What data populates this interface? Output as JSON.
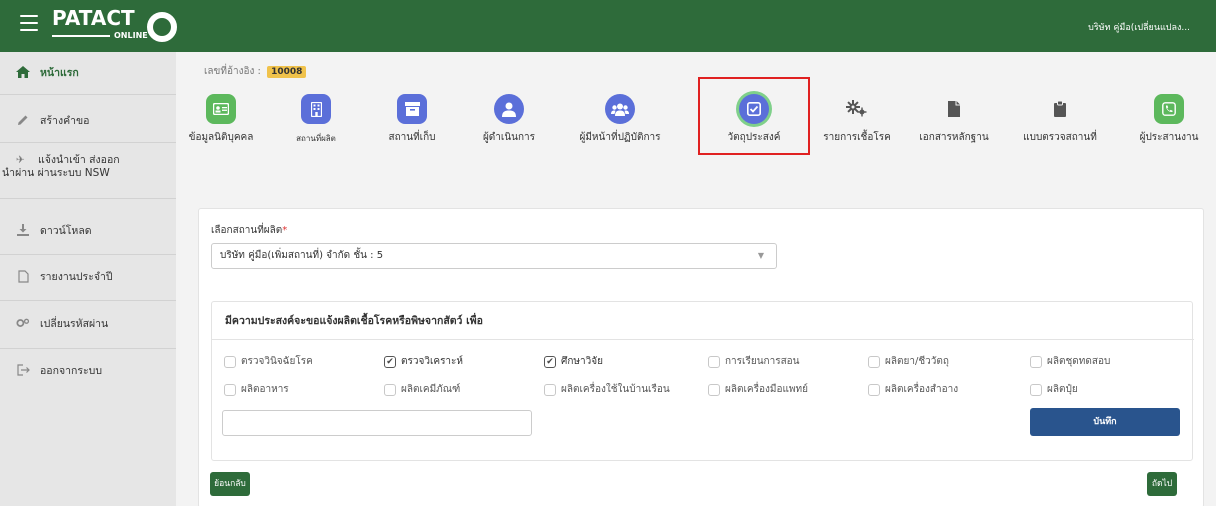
{
  "header": {
    "logo_text": "PATACT",
    "logo_sub": "ONLINE",
    "company": "บริษัท คู่มือ(เปลี่ยนแปลง..."
  },
  "sidebar": {
    "items": [
      {
        "label": "หน้าแรก",
        "icon": "home-icon"
      },
      {
        "label": "สร้างคำขอ",
        "icon": "pencil-icon"
      },
      {
        "label": "แจ้งนำเข้า ส่งออก",
        "label2": "นำผ่าน ผ่านระบบ NSW",
        "icon": "plane-icon"
      },
      {
        "label": "ดาวน์โหลด",
        "icon": "download-icon"
      },
      {
        "label": "รายงานประจำปี",
        "icon": "file-icon"
      },
      {
        "label": "เปลี่ยนรหัสผ่าน",
        "icon": "cogs-icon"
      },
      {
        "label": "ออกจากระบบ",
        "icon": "sign-out-icon"
      }
    ]
  },
  "reference": {
    "label": "เลขที่อ้างอิง :",
    "value": "10008"
  },
  "steps": [
    {
      "label": "ข้อมูลนิติบุคคล",
      "icon": "id-card-icon",
      "color": "#5cb85c"
    },
    {
      "label": "สถานที่ผลิต",
      "icon": "building-icon",
      "color": "#5b6fd9"
    },
    {
      "label": "สถานที่เก็บ",
      "icon": "archive-icon",
      "color": "#5b6fd9"
    },
    {
      "label": "ผู้ดำเนินการ",
      "icon": "user-icon",
      "color": "#5b6fd9"
    },
    {
      "label": "ผู้มีหน้าที่ปฏิบัติการ",
      "icon": "users-icon",
      "color": "#5b6fd9"
    },
    {
      "label": "วัตถุประสงค์",
      "icon": "check-square-icon",
      "color": "#5b6fd9"
    },
    {
      "label": "รายการเชื้อโรค",
      "icon": "cogs-icon",
      "color": "#666666"
    },
    {
      "label": "เอกสารหลักฐาน",
      "icon": "document-icon",
      "color": "#555555"
    },
    {
      "label": "แบบตรวจสถานที่",
      "icon": "clipboard-icon",
      "color": "#555555"
    },
    {
      "label": "ผู้ประสานงาน",
      "icon": "phone-icon",
      "color": "#5cb85c"
    }
  ],
  "form": {
    "select_label": "เลือกสถานที่ผลิต",
    "required_mark": "*",
    "selected_site": "บริษัท คู่มือ(เพิ่มสถานที่) จำกัด ชั้น : 5",
    "purpose_title": "มีความประสงค์จะขอแจ้งผลิตเชื้อโรคหรือพิษจากสัตว์ เพื่อ",
    "checkboxes": [
      {
        "label": "ตรวจวินิจฉัยโรค",
        "checked": false
      },
      {
        "label": "ตรวจวิเคราะห์",
        "checked": true
      },
      {
        "label": "ศึกษาวิจัย",
        "checked": true
      },
      {
        "label": "การเรียนการสอน",
        "checked": false
      },
      {
        "label": "ผลิตยา/ชีววัตถุ",
        "checked": false
      },
      {
        "label": "ผลิตชุดทดสอบ",
        "checked": false
      },
      {
        "label": "ผลิตอาหาร",
        "checked": false
      },
      {
        "label": "ผลิตเคมีภัณฑ์",
        "checked": false
      },
      {
        "label": "ผลิตเครื่องใช้ในบ้านเรือน",
        "checked": false
      },
      {
        "label": "ผลิตเครื่องมือแพทย์",
        "checked": false
      },
      {
        "label": "ผลิตเครื่องสำอาง",
        "checked": false
      },
      {
        "label": "ผลิตปุ๋ย",
        "checked": false
      }
    ],
    "other_value": "",
    "save_label": "บันทึก"
  },
  "nav": {
    "back_label": "ย้อนกลับ",
    "next_label": "ถัดไป"
  },
  "colors": {
    "brand_green": "#2e6b3a",
    "save_blue": "#29548d",
    "highlight_red": "#e02020",
    "badge_yellow": "#f0c24b"
  }
}
